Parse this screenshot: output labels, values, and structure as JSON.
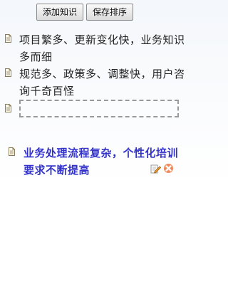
{
  "toolbar": {
    "add_label": "添加知识",
    "save_label": "保存排序"
  },
  "items": [
    {
      "text": "项目繁多、更新变化快，业务知识多而细"
    },
    {
      "text": "规范多、政策多、调整快，用户咨询千奇百怪"
    }
  ],
  "highlight_item": {
    "text": "业务处理流程复杂，个性化培训要求不断提高",
    "color": "#3333cc"
  },
  "icons": {
    "doc": "document-icon",
    "edit": "edit-icon",
    "delete": "delete-icon"
  }
}
